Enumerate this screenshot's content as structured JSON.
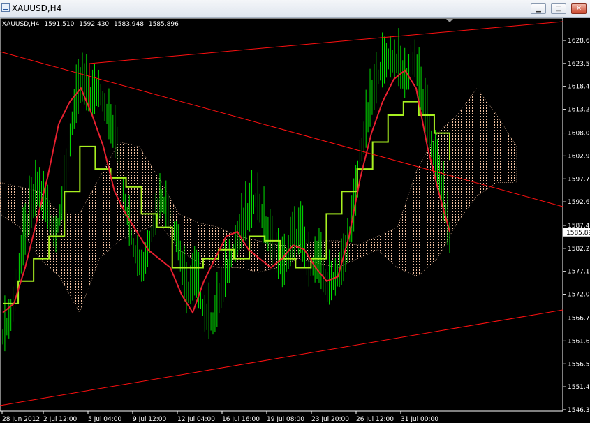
{
  "window": {
    "title": "XAUUSD,H4",
    "buttons": {
      "minimize": "▁",
      "maximize": "□",
      "close": "✕"
    }
  },
  "chart_header": {
    "symbol": "XAUUSD,H4",
    "open": "1591.510",
    "high": "1592.430",
    "low": "1583.948",
    "close": "1585.896"
  },
  "colors": {
    "background": "#000000",
    "candles": "#00e000",
    "kijun": "#a8f020",
    "tenkan": "#e82030",
    "cloud": "#f0c0a0",
    "trendline": "#ff1010",
    "axis": "#ffffff",
    "price_line": "#c0c0c0"
  },
  "chart_data": {
    "type": "line",
    "instrument": "XAUUSD",
    "timeframe": "H4",
    "ylim": [
      1546.33,
      1628.64
    ],
    "x_ticks": [
      "28 Jun 2012",
      "2 Jul 12:00",
      "5 Jul 04:00",
      "9 Jul 12:00",
      "12 Jul 04:00",
      "16 Jul 16:00",
      "19 Jul 08:00",
      "23 Jul 20:00",
      "26 Jul 12:00",
      "31 Jul 00:00"
    ],
    "y_ticks": [
      "1628.64",
      "1623.52",
      "1618.41",
      "1613.29",
      "1608.02",
      "1602.91",
      "1597.79",
      "1592.68",
      "1587.41",
      "1582.29",
      "1577.18",
      "1572.06",
      "1566.79",
      "1561.68",
      "1556.56",
      "1551.45",
      "1546.33"
    ],
    "current_price": "1585.89",
    "price_series": [
      1563,
      1568,
      1580,
      1590,
      1596,
      1592,
      1585,
      1595,
      1612,
      1620,
      1616,
      1618,
      1612,
      1606,
      1592,
      1582,
      1578,
      1586,
      1594,
      1590,
      1584,
      1572,
      1577,
      1568,
      1566,
      1574,
      1580,
      1586,
      1590,
      1594,
      1587,
      1582,
      1578,
      1584,
      1586,
      1578,
      1580,
      1574,
      1576,
      1580,
      1590,
      1605,
      1615,
      1622,
      1625,
      1624,
      1620,
      1625,
      1615,
      1605,
      1597,
      1585
    ],
    "tenkan": [
      1568,
      1570,
      1578,
      1588,
      1598,
      1610,
      1615,
      1618,
      1612,
      1605,
      1595,
      1590,
      1586,
      1582,
      1580,
      1578,
      1572,
      1568,
      1575,
      1580,
      1585,
      1586,
      1582,
      1580,
      1578,
      1580,
      1583,
      1582,
      1578,
      1575,
      1576,
      1585,
      1598,
      1608,
      1615,
      1620,
      1622,
      1618,
      1605,
      1595,
      1586
    ],
    "kijun": [
      1570,
      1575,
      1580,
      1585,
      1595,
      1605,
      1600,
      1598,
      1596,
      1590,
      1587,
      1578,
      1578,
      1580,
      1582,
      1580,
      1585,
      1584,
      1580,
      1578,
      1580,
      1590,
      1595,
      1600,
      1606,
      1612,
      1615,
      1612,
      1608,
      1602
    ],
    "cloud_top": [
      1597,
      1596,
      1595,
      1590,
      1590,
      1598,
      1606,
      1605,
      1598,
      1590,
      1588,
      1587,
      1585,
      1584,
      1583,
      1583,
      1584,
      1584,
      1583,
      1585,
      1587,
      1600,
      1608,
      1612,
      1618,
      1612,
      1605
    ],
    "cloud_bottom": [
      1590,
      1587,
      1580,
      1576,
      1568,
      1580,
      1584,
      1586,
      1588,
      1582,
      1579,
      1578,
      1578,
      1577,
      1578,
      1580,
      1579,
      1578,
      1580,
      1582,
      1578,
      1576,
      1580,
      1588,
      1594,
      1597,
      1597
    ],
    "trendlines": [
      {
        "from": [
          "28 Jun 2012",
          1616
        ],
        "to": [
          "31 Jul 00:00",
          1592
        ]
      },
      {
        "from": [
          "5 Jul 04:00",
          1623
        ],
        "to": [
          "31 Jul 00:00",
          1630
        ]
      },
      {
        "from": [
          "28 Jun 2012",
          1546
        ],
        "to": [
          "31 Jul 00:00",
          1568
        ]
      }
    ]
  }
}
